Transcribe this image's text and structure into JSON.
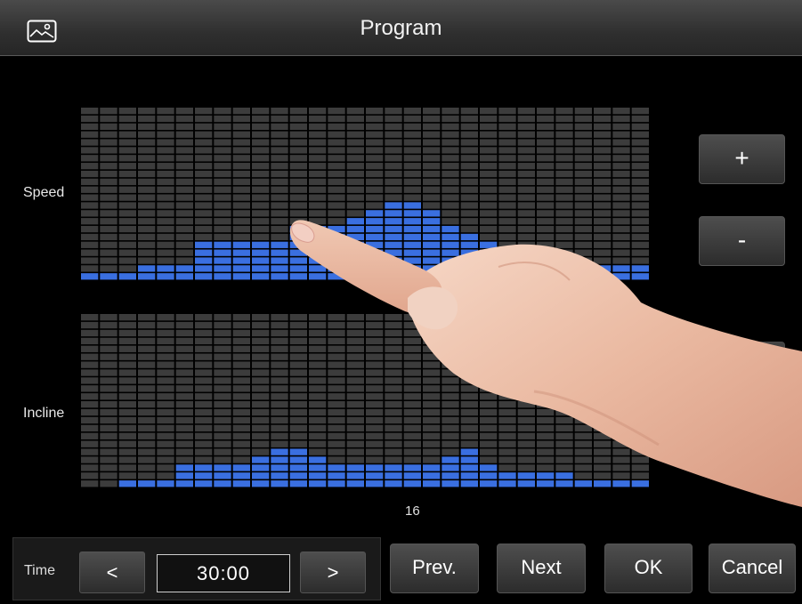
{
  "header": {
    "title": "Program",
    "icon": "image-icon"
  },
  "labels": {
    "speed": "Speed",
    "incline": "Incline"
  },
  "side_buttons": {
    "plus": "+",
    "minus": "-"
  },
  "current_step": "16",
  "time": {
    "label": "Time",
    "prev": "<",
    "next": ">",
    "value": "30:00"
  },
  "nav": {
    "prev": "Prev.",
    "next": "Next",
    "ok": "OK",
    "cancel": "Cancel"
  },
  "colors": {
    "bar_on": "#3a6fe0",
    "bar_off": "#3c3c3c",
    "background": "#000000"
  },
  "speed_levels": [
    1,
    1,
    1,
    2,
    2,
    2,
    5,
    5,
    5,
    5,
    5,
    7,
    7,
    7,
    8,
    9,
    10,
    10,
    9,
    7,
    6,
    5,
    3,
    3,
    2,
    2,
    2,
    2,
    2,
    2
  ],
  "incline_levels": [
    0,
    0,
    1,
    1,
    1,
    3,
    3,
    3,
    3,
    4,
    5,
    5,
    4,
    3,
    3,
    3,
    3,
    3,
    3,
    4,
    5,
    3,
    2,
    2,
    2,
    2,
    1,
    1,
    1,
    1
  ]
}
